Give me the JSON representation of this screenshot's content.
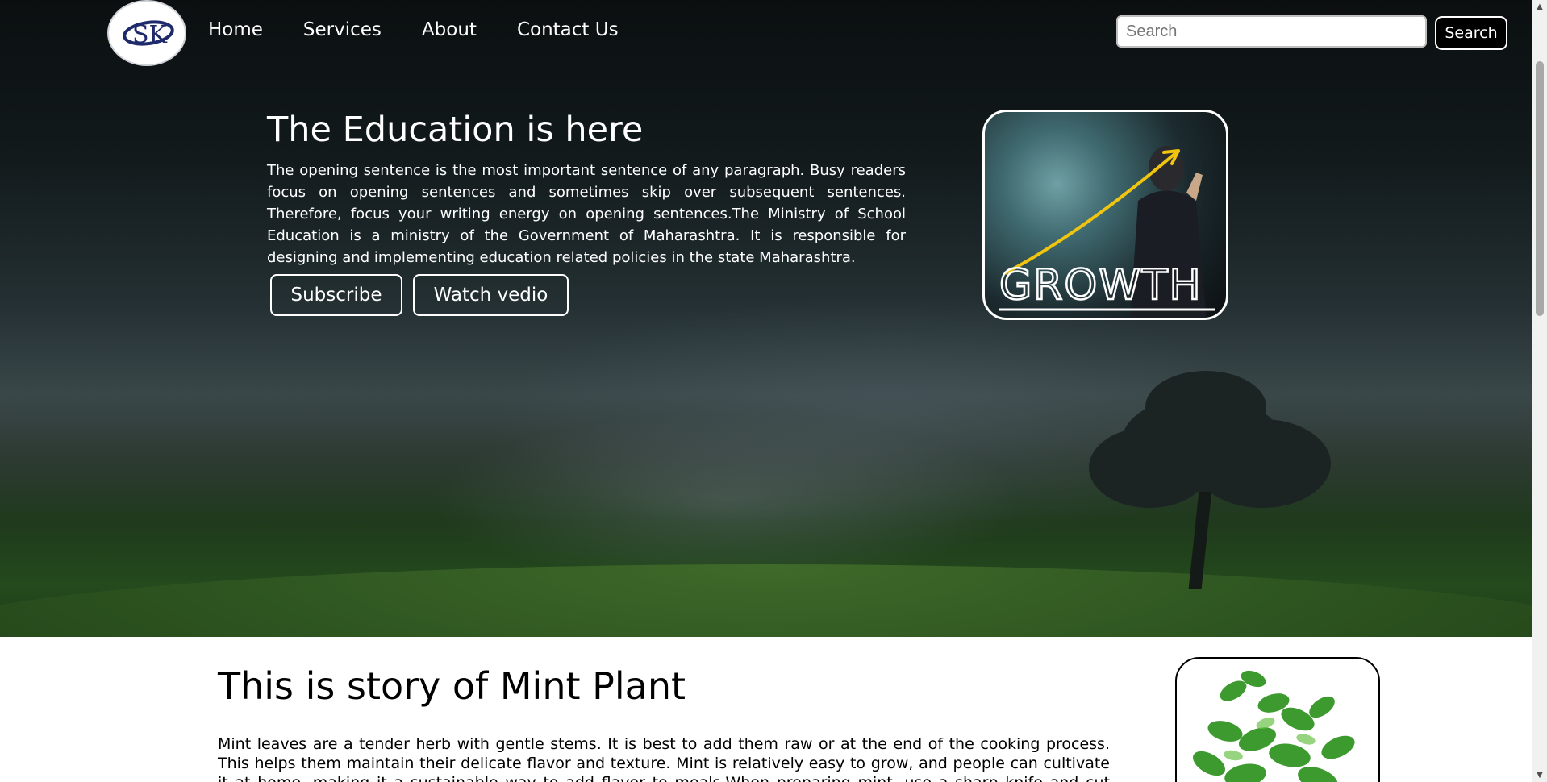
{
  "logo": {
    "text": "SK"
  },
  "nav": {
    "items": [
      "Home",
      "Services",
      "About",
      "Contact Us"
    ]
  },
  "search": {
    "placeholder": "Search",
    "button_label": "Search"
  },
  "hero": {
    "title": "The Education is here",
    "paragraph": "The opening sentence is the most important sentence of any paragraph. Busy readers focus on opening sentences and sometimes skip over subsequent sentences. Therefore, focus your writing energy on opening sentences.The Ministry of School Education is a ministry of the Government of Maharashtra. It is responsible for designing and implementing education related policies in the state Maharashtra.",
    "subscribe_label": "Subscribe",
    "watch_label": "Watch vedio",
    "image_text": "GROWTH"
  },
  "story": {
    "title": "This is story of Mint Plant",
    "paragraph": "Mint leaves are a tender herb with gentle stems. It is best to add them raw or at the end of the cooking process. This helps them maintain their delicate flavor and texture. Mint is relatively easy to grow, and people can cultivate it at home, making it a sustainable way to add flavor to meals.When preparing mint, use a sharp knife and cut gently. Using a dull"
  },
  "colors": {
    "accent_yellow": "#f1c40f",
    "logo_navy": "#1f2a6b"
  }
}
